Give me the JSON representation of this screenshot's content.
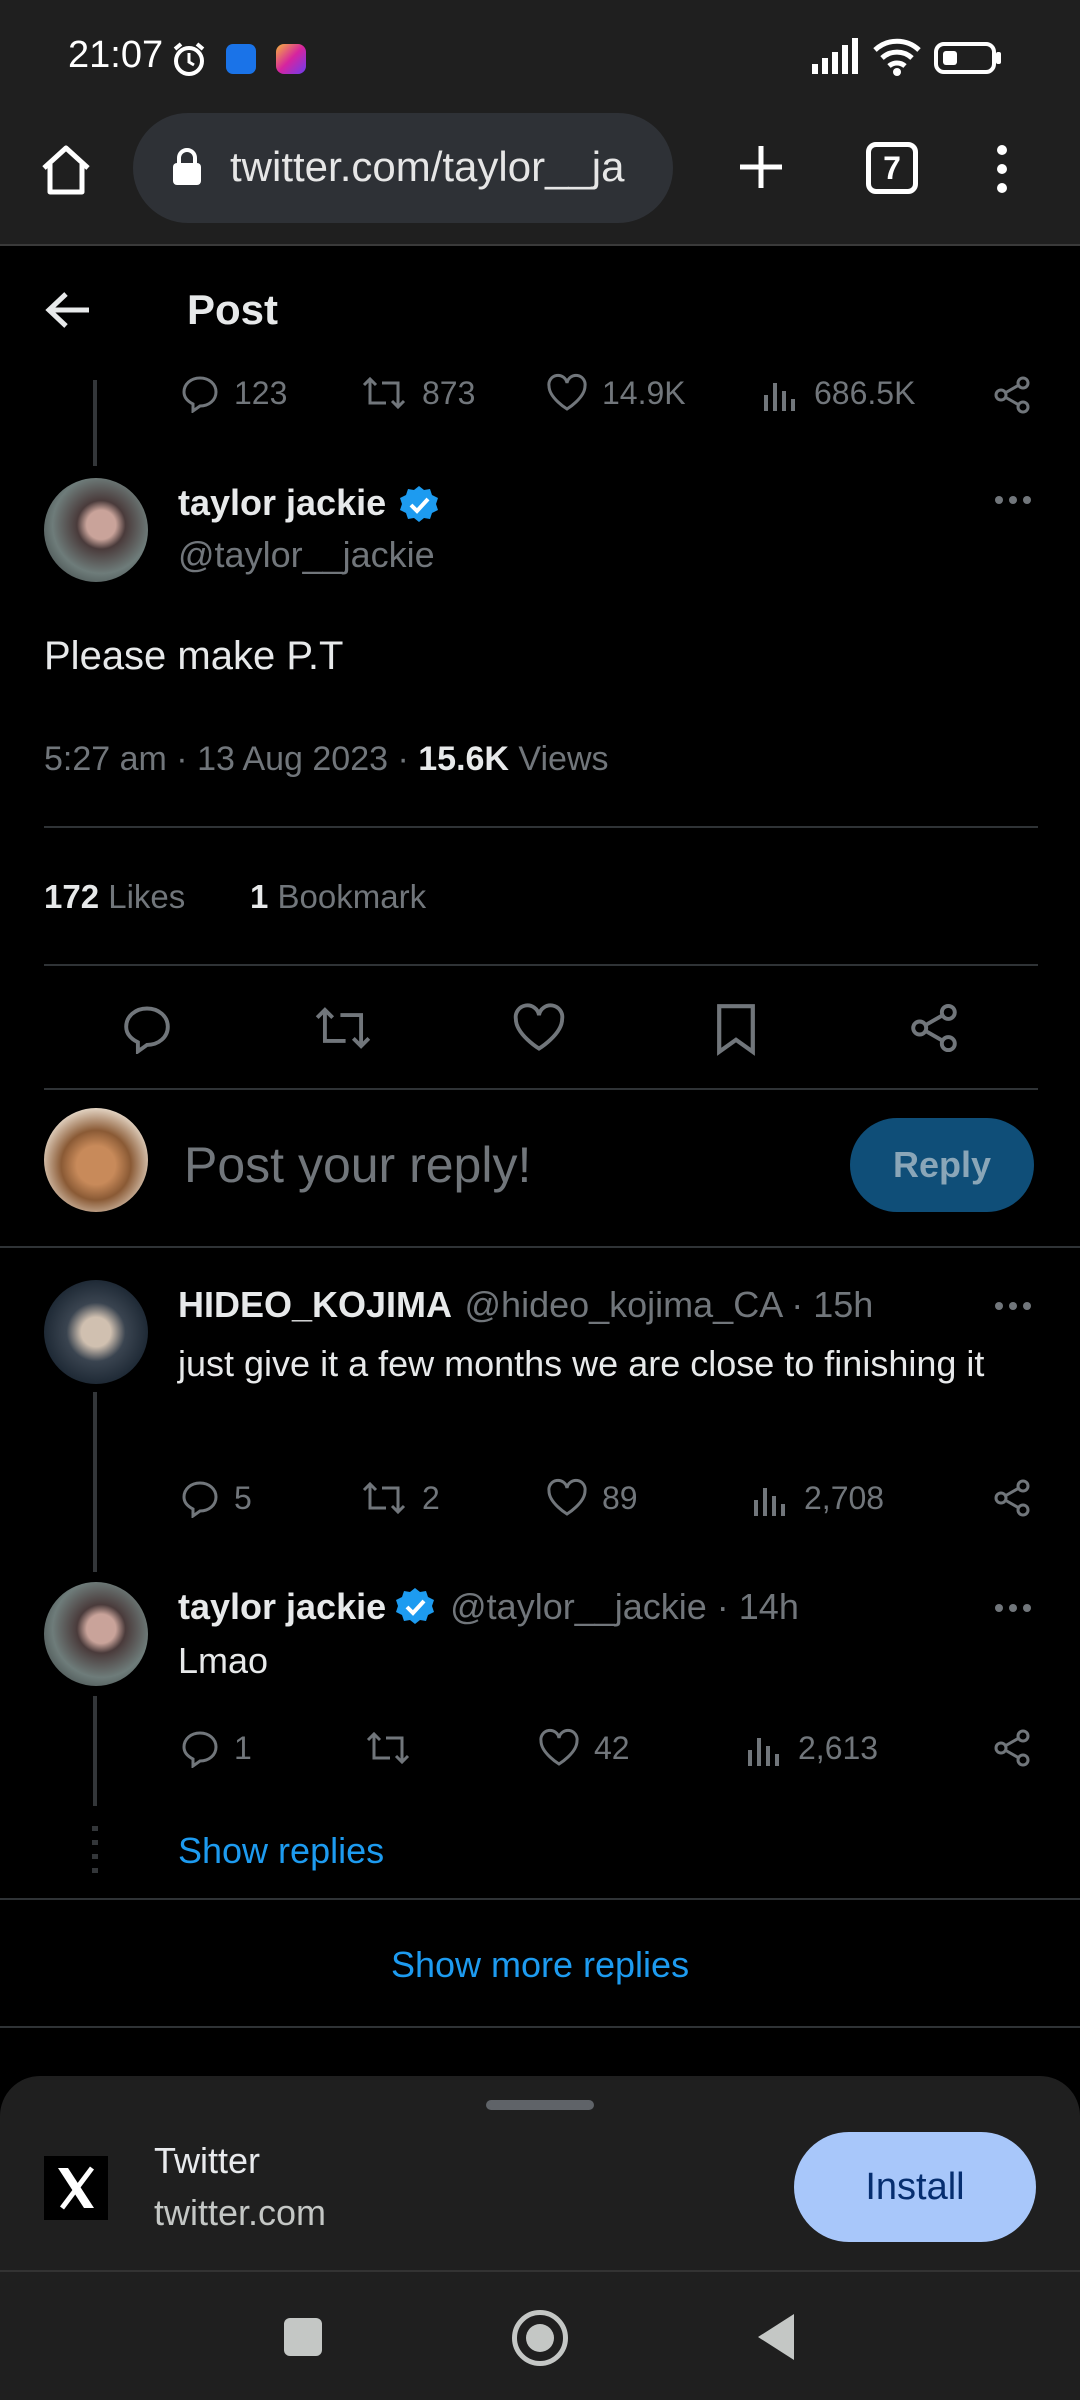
{
  "status_bar": {
    "time": "21:07",
    "tab_count": "7"
  },
  "browser": {
    "url": "twitter.com/taylor__ja"
  },
  "header": {
    "title": "Post"
  },
  "prev_stats": {
    "replies": "123",
    "reposts": "873",
    "likes": "14.9K",
    "views": "686.5K"
  },
  "main_post": {
    "name": "taylor jackie",
    "handle": "@taylor__jackie",
    "text": "Please make P.T",
    "time_date": "5:27 am · 13 Aug 2023 · ",
    "views_count": "15.6K",
    "views_label": " Views",
    "likes_count": "172",
    "likes_label": " Likes",
    "bookmarks_count": "1",
    "bookmarks_label": " Bookmark"
  },
  "reply_box": {
    "placeholder": "Post your reply!",
    "button": "Reply"
  },
  "replies": [
    {
      "name": "HIDEO_KOJIMA",
      "handle": "@hideo_kojima_CA · 15h",
      "text": "just give it a few months we are close to finishing it",
      "replies": "5",
      "reposts": "2",
      "likes": "89",
      "views": "2,708"
    },
    {
      "name": "taylor jackie",
      "handle": "@taylor__jackie · 14h",
      "text": "Lmao",
      "replies": "1",
      "reposts": "",
      "likes": "42",
      "views": "2,613"
    }
  ],
  "show_replies": "Show replies",
  "show_more_replies": "Show more replies",
  "app_banner": {
    "name": "Twitter",
    "domain": "twitter.com",
    "button": "Install"
  },
  "colors": {
    "accent": "#1d9bf0",
    "reply_button": "#0f4e78",
    "install_button": "#a8c7fa"
  }
}
